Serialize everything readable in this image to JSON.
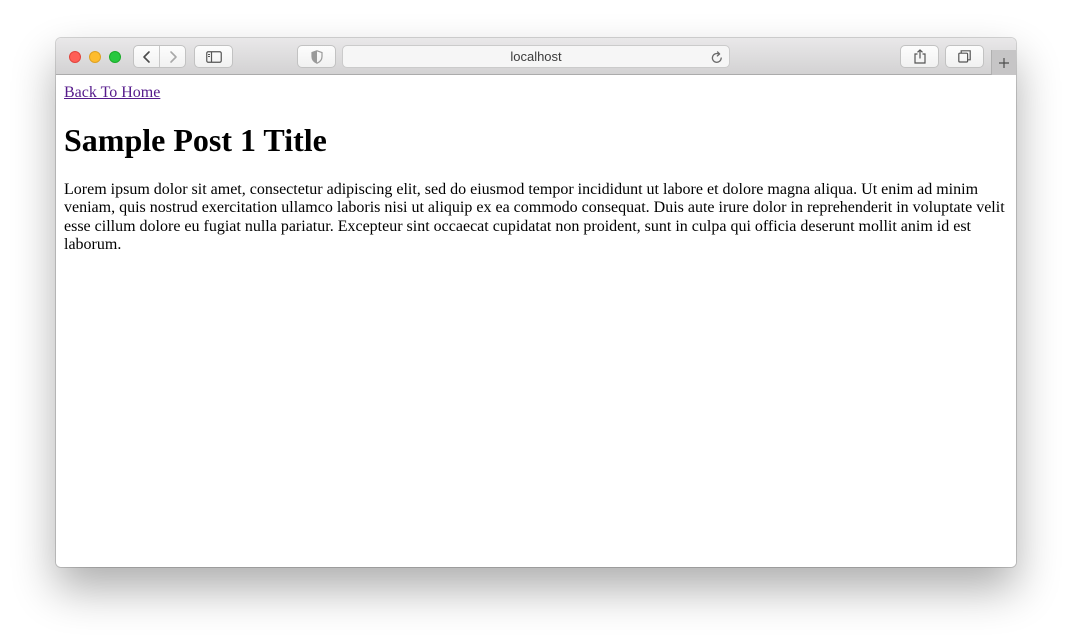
{
  "browser": {
    "url": "localhost",
    "icons": {
      "back": "chevron-left-icon",
      "forward": "chevron-right-icon",
      "sidebar": "sidebar-icon",
      "privacy": "shield-icon",
      "reload": "reload-icon",
      "share": "share-icon",
      "tabs": "tabs-overview-icon",
      "new_tab": "plus-icon"
    },
    "colors": {
      "close": "#fe5f57",
      "minimize": "#febc2e",
      "maximize": "#28c840"
    }
  },
  "page": {
    "back_link": "Back To Home",
    "title": "Sample Post 1 Title",
    "body": "Lorem ipsum dolor sit amet, consectetur adipiscing elit, sed do eiusmod tempor incididunt ut labore et dolore magna aliqua. Ut enim ad minim veniam, quis nostrud exercitation ullamco laboris nisi ut aliquip ex ea commodo consequat. Duis aute irure dolor in reprehenderit in voluptate velit esse cillum dolore eu fugiat nulla pariatur. Excepteur sint occaecat cupidatat non proident, sunt in culpa qui officia deserunt mollit anim id est laborum.",
    "link_color": "#551a8b"
  }
}
